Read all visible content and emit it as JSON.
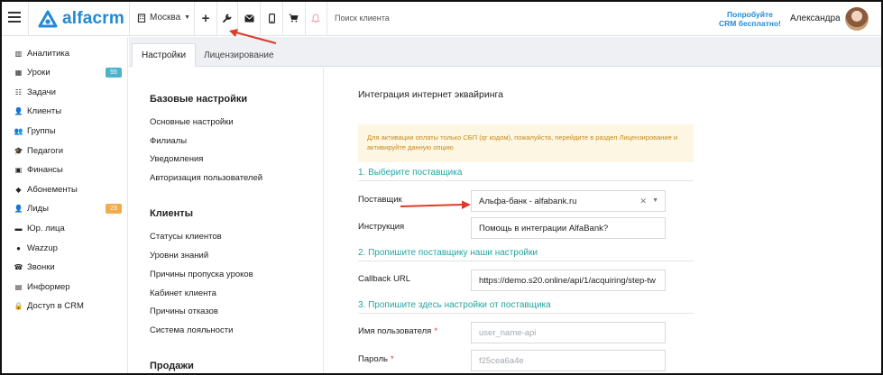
{
  "topbar": {
    "logo_text": "alfacrm",
    "city": "Москва",
    "search_placeholder": "Поиск клиента",
    "trial_line1": "Попробуйте",
    "trial_line2": "CRM бесплатно!",
    "user_name": "Александра",
    "colors": {
      "brand": "#1f8ad6"
    }
  },
  "sidebar": {
    "items": [
      {
        "label": "Аналитика",
        "icon": "chart-icon"
      },
      {
        "label": "Уроки",
        "icon": "calendar-icon",
        "badge": "55",
        "badge_color": "#4db3cc"
      },
      {
        "label": "Задачи",
        "icon": "tasks-icon"
      },
      {
        "label": "Клиенты",
        "icon": "user-icon"
      },
      {
        "label": "Группы",
        "icon": "users-icon"
      },
      {
        "label": "Педагоги",
        "icon": "graduation-cap-icon"
      },
      {
        "label": "Финансы",
        "icon": "money-icon"
      },
      {
        "label": "Абонементы",
        "icon": "tag-icon"
      },
      {
        "label": "Лиды",
        "icon": "user-plus-icon",
        "badge": "23",
        "badge_color": "#f0ad4e"
      },
      {
        "label": "Юр. лица",
        "icon": "briefcase-icon"
      },
      {
        "label": "Wazzup",
        "icon": "whatsapp-icon"
      },
      {
        "label": "Звонки",
        "icon": "phone-icon"
      },
      {
        "label": "Информер",
        "icon": "phone-device-icon"
      },
      {
        "label": "Доступ в CRM",
        "icon": "lock-icon"
      }
    ]
  },
  "tabs": [
    {
      "label": "Настройки",
      "active": true
    },
    {
      "label": "Лицензирование",
      "active": false
    }
  ],
  "menu": {
    "sections": [
      {
        "heading": "Базовые настройки",
        "items": [
          "Основные настройки",
          "Филиалы",
          "Уведомления",
          "Авторизация пользователей"
        ]
      },
      {
        "heading": "Клиенты",
        "items": [
          "Статусы клиентов",
          "Уровни знаний",
          "Причины пропуска уроков",
          "Кабинет клиента",
          "Причины отказов",
          "Система лояльности"
        ]
      },
      {
        "heading": "Продажи",
        "items": []
      }
    ]
  },
  "content": {
    "title": "Интеграция интернет эквайринга",
    "alert": "Для активации оплаты только СБП (qr кодом), пожалуйста, перейдите в раздел Лицензирование и активируйте данную опцию",
    "section1": "1. Выберите поставщика",
    "provider_label": "Поставщик",
    "provider_value": "Альфа-банк - alfabank.ru",
    "instruction_label": "Инструкция",
    "instruction_value": "Помощь в интеграции AlfaBank?",
    "section2": "2. Пропишите поставщику наши настройки",
    "callback_label": "Callback URL",
    "callback_value": "https://demo.s20.online/api/1/acquiring/step-tw",
    "section3": "3. Пропишите здесь настройки от поставщика",
    "username_label": "Имя пользователя",
    "username_placeholder": "user_name-api",
    "password_label": "Пароль",
    "password_placeholder": "f25cea6a4e",
    "colors": {
      "section": "#22a6a0",
      "alert_bg": "#fcf6e3",
      "alert_text": "#c98a1a",
      "required": "#e0402e"
    }
  },
  "annotations": {
    "arrow_color": "#e0392b"
  }
}
